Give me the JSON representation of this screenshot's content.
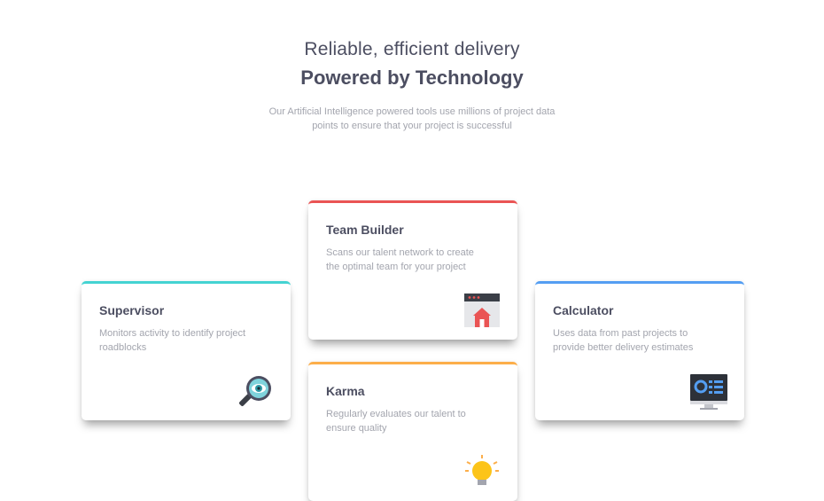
{
  "header": {
    "tagline": "Reliable, efficient delivery",
    "headline": "Powered by Technology",
    "intro_line1": "Our Artificial Intelligence powered tools use millions of project data",
    "intro_line2": "points to ensure that your project is successful"
  },
  "cards": {
    "supervisor": {
      "title": "Supervisor",
      "desc_line1": "Monitors activity to identify project",
      "desc_line2": "roadblocks",
      "accent": "#44d3d2",
      "icon": "magnifier-icon"
    },
    "team_builder": {
      "title": "Team Builder",
      "desc_line1": "Scans our talent network to create",
      "desc_line2": "the optimal team for your project",
      "accent": "#ea5454",
      "icon": "team-builder-icon"
    },
    "karma": {
      "title": "Karma",
      "desc_line1": "Regularly evaluates our talent to",
      "desc_line2": "ensure quality",
      "accent": "#fcae4a",
      "icon": "lightbulb-icon"
    },
    "calculator": {
      "title": "Calculator",
      "desc_line1": "Uses data from past projects to",
      "desc_line2": "provide better delivery estimates",
      "accent": "#549ef2",
      "icon": "monitor-icon"
    }
  }
}
